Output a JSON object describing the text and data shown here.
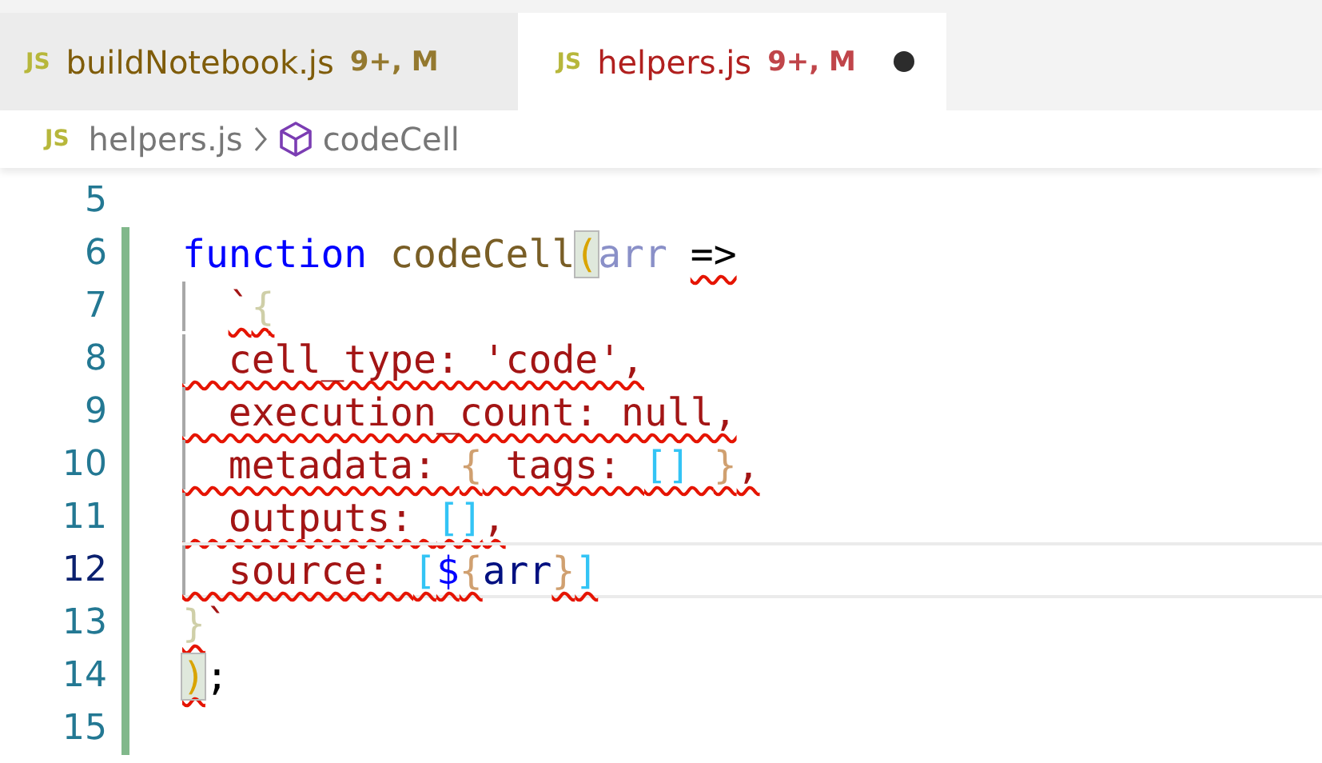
{
  "tabs": [
    {
      "icon": "JS",
      "label": "buildNotebook.js",
      "badge": "9+, M",
      "selected": false,
      "dirty": false
    },
    {
      "icon": "JS",
      "label": "helpers.js",
      "badge": "9+, M",
      "selected": true,
      "dirty": true
    }
  ],
  "breadcrumbs": [
    {
      "kind": "file",
      "icon": "JS",
      "label": "helpers.js"
    },
    {
      "kind": "symbol",
      "label": "codeCell"
    }
  ],
  "editor": {
    "lines": [
      {
        "number": "5",
        "added": false,
        "current": false,
        "guide": false
      },
      {
        "number": "6",
        "added": true,
        "current": false,
        "guide": false,
        "tokens": [
          {
            "text": "function ",
            "kind": "keyword",
            "error": false
          },
          {
            "text": "codeCell",
            "kind": "function",
            "error": false
          },
          {
            "text": "(",
            "kind": "match",
            "error": false
          },
          {
            "text": "arr ",
            "kind": "unused",
            "error": false
          },
          {
            "text": "=>",
            "kind": "plain",
            "error": true
          }
        ]
      },
      {
        "number": "7",
        "added": true,
        "current": false,
        "guide": true,
        "indent": true,
        "tokens": [
          {
            "text": "`",
            "kind": "string",
            "error": true
          },
          {
            "text": "{",
            "kind": "faded",
            "error": true
          }
        ]
      },
      {
        "number": "8",
        "added": true,
        "current": false,
        "guide": true,
        "tokens": [
          {
            "text": "  cell_type: 'code',",
            "kind": "string",
            "error": true
          }
        ]
      },
      {
        "number": "9",
        "added": true,
        "current": false,
        "guide": true,
        "tokens": [
          {
            "text": "  execution_count: null,",
            "kind": "string",
            "error": true
          }
        ]
      },
      {
        "number": "10",
        "added": true,
        "current": false,
        "guide": true,
        "tokens": [
          {
            "text": "  metadata: ",
            "kind": "string",
            "error": true
          },
          {
            "text": "{",
            "kind": "brace",
            "error": true
          },
          {
            "text": " tags: ",
            "kind": "string",
            "error": true
          },
          {
            "text": "[] ",
            "kind": "bracket",
            "error": true
          },
          {
            "text": "}",
            "kind": "brace",
            "error": true
          },
          {
            "text": ",",
            "kind": "string",
            "error": true
          }
        ]
      },
      {
        "number": "11",
        "added": true,
        "current": false,
        "guide": true,
        "tokens": [
          {
            "text": "  outputs: ",
            "kind": "string",
            "error": true
          },
          {
            "text": "[]",
            "kind": "bracket",
            "error": true
          },
          {
            "text": ",",
            "kind": "string",
            "error": true
          }
        ]
      },
      {
        "number": "12",
        "added": true,
        "current": true,
        "guide": true,
        "tokens": [
          {
            "text": "  source: ",
            "kind": "string",
            "error": true
          },
          {
            "text": "[",
            "kind": "bracket",
            "error": true
          },
          {
            "text": "$",
            "kind": "keyword",
            "error": true
          },
          {
            "text": "{",
            "kind": "brace",
            "error": true
          },
          {
            "text": "arr",
            "kind": "variable",
            "error": false
          },
          {
            "text": "}",
            "kind": "brace",
            "error": true
          },
          {
            "text": "]",
            "kind": "bracket",
            "error": true
          }
        ]
      },
      {
        "number": "13",
        "added": true,
        "current": false,
        "guide": false,
        "tokens": [
          {
            "text": "}",
            "kind": "faded",
            "error": true
          },
          {
            "text": "`",
            "kind": "string",
            "error": false
          }
        ]
      },
      {
        "number": "14",
        "added": true,
        "current": false,
        "guide": false,
        "tokens": [
          {
            "text": ")",
            "kind": "match",
            "error": true
          },
          {
            "text": ";",
            "kind": "plain",
            "error": false
          }
        ]
      },
      {
        "number": "15",
        "added": true,
        "current": false,
        "guide": false
      }
    ]
  }
}
